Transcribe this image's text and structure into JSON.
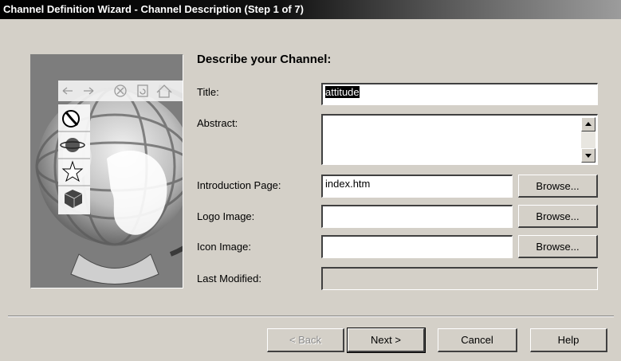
{
  "window": {
    "title": "Channel Definition Wizard - Channel Description (Step 1 of 7)"
  },
  "main": {
    "heading": "Describe your Channel:",
    "fields": {
      "title": {
        "label": "Title:",
        "value": "attitude"
      },
      "abstract": {
        "label": "Abstract:",
        "value": ""
      },
      "intro_page": {
        "label": "Introduction Page:",
        "value": "index.htm"
      },
      "logo_image": {
        "label": "Logo Image:",
        "value": ""
      },
      "icon_image": {
        "label": "Icon Image:",
        "value": ""
      },
      "last_modified": {
        "label": "Last Modified:",
        "value": ""
      }
    },
    "browse_label": "Browse..."
  },
  "buttons": {
    "back": "< Back",
    "next": "Next >",
    "cancel": "Cancel",
    "help": "Help"
  },
  "colors": {
    "dialog_bg": "#d4d0c8",
    "title_bg": "#000000",
    "selection_bg": "#000000"
  },
  "icons": [
    "back-arrow-icon",
    "forward-arrow-icon",
    "stop-icon",
    "refresh-icon",
    "home-icon",
    "channel-guide-icon",
    "planet-icon",
    "star-icon",
    "box-icon",
    "globe-artwork"
  ]
}
